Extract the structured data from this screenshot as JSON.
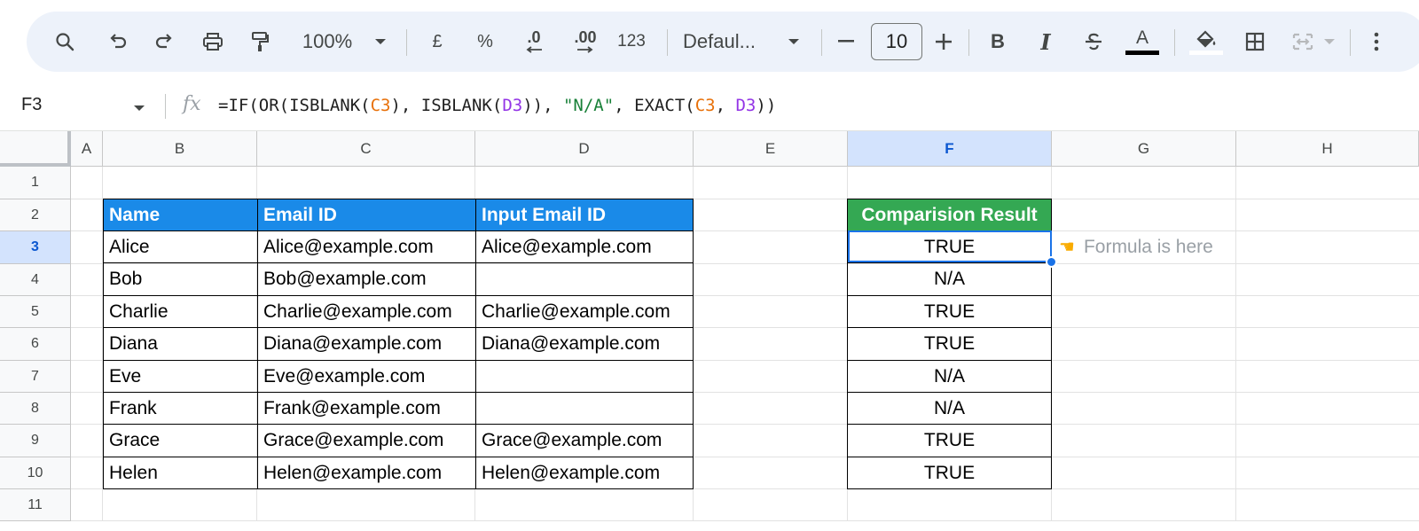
{
  "toolbar": {
    "zoom": "100%",
    "currency": "£",
    "percent": "%",
    "decrease_decimal": ".0",
    "increase_decimal": ".00",
    "number_format": "123",
    "font_family": "Defaul...",
    "font_size": "10",
    "bold": "B",
    "italic": "I",
    "text_color_letter": "A"
  },
  "formula_bar": {
    "cell_ref": "F3",
    "fx_label": "fx",
    "formula_parts": [
      "=IF(OR(ISBLANK(",
      "C3",
      "), ISBLANK(",
      "D3",
      ")), ",
      "\"N/A\"",
      ", EXACT(",
      "C3",
      ", ",
      "D3",
      "))"
    ]
  },
  "columns": [
    "A",
    "B",
    "C",
    "D",
    "E",
    "F",
    "G",
    "H"
  ],
  "active_column": "F",
  "rows": [
    "1",
    "2",
    "3",
    "4",
    "5",
    "6",
    "7",
    "8",
    "9",
    "10",
    "11"
  ],
  "active_row": "3",
  "table": {
    "headers": [
      "Name",
      "Email ID",
      "Input Email ID"
    ],
    "rows": [
      [
        "Alice",
        "Alice@example.com",
        "Alice@example.com"
      ],
      [
        "Bob",
        "Bob@example.com",
        ""
      ],
      [
        "Charlie",
        "Charlie@example.com",
        "Charlie@example.com"
      ],
      [
        "Diana",
        "Diana@example.com",
        "Diana@example.com"
      ],
      [
        "Eve",
        "Eve@example.com",
        ""
      ],
      [
        "Frank",
        "Frank@example.com",
        ""
      ],
      [
        "Grace",
        "Grace@example.com",
        "Grace@example.com"
      ],
      [
        "Helen",
        "Helen@example.com",
        "Helen@example.com"
      ]
    ]
  },
  "results": {
    "header": "Comparision Result",
    "values": [
      "TRUE",
      "N/A",
      "TRUE",
      "TRUE",
      "N/A",
      "N/A",
      "TRUE",
      "TRUE"
    ]
  },
  "note": {
    "icon": "pointing-hand-icon",
    "text": "Formula is here"
  },
  "colors": {
    "header_blue": "#1a8ae8",
    "header_green": "#34a853",
    "selection": "#1a73e8"
  }
}
